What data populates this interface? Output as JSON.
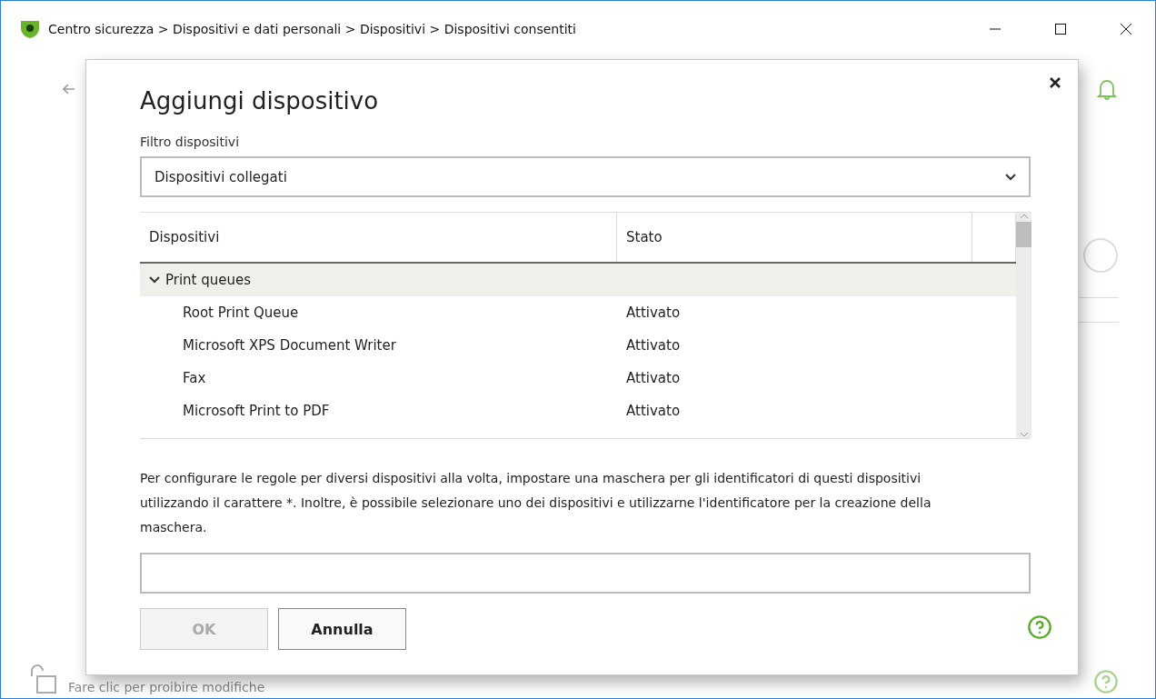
{
  "window": {
    "title": "Centro sicurezza > Dispositivi e dati personali > Dispositivi > Dispositivi consentiti"
  },
  "background": {
    "lock_hint": "Fare clic per proibire modifiche"
  },
  "dialog": {
    "title": "Aggiungi dispositivo",
    "filter_label": "Filtro dispositivi",
    "filter_value": "Dispositivi collegati",
    "table": {
      "columns": [
        "Dispositivi",
        "Stato"
      ],
      "groups": [
        {
          "name": "Print queues",
          "expanded": true,
          "children": [
            {
              "name": "Root Print Queue",
              "status": "Attivato"
            },
            {
              "name": "Microsoft XPS Document Writer",
              "status": "Attivato"
            },
            {
              "name": "Fax",
              "status": "Attivato"
            },
            {
              "name": "Microsoft Print to PDF",
              "status": "Attivato"
            }
          ]
        }
      ]
    },
    "description": "Per configurare le regole per diversi dispositivi alla volta, impostare una maschera per gli identificatori di questi dispositivi utilizzando il carattere *. Inoltre, è possibile selezionare uno dei dispositivi e utilizzarne l'identificatore per la creazione della maschera.",
    "buttons": [
      {
        "label": "OK",
        "disabled": true
      },
      {
        "label": "Annulla",
        "disabled": false
      }
    ]
  }
}
